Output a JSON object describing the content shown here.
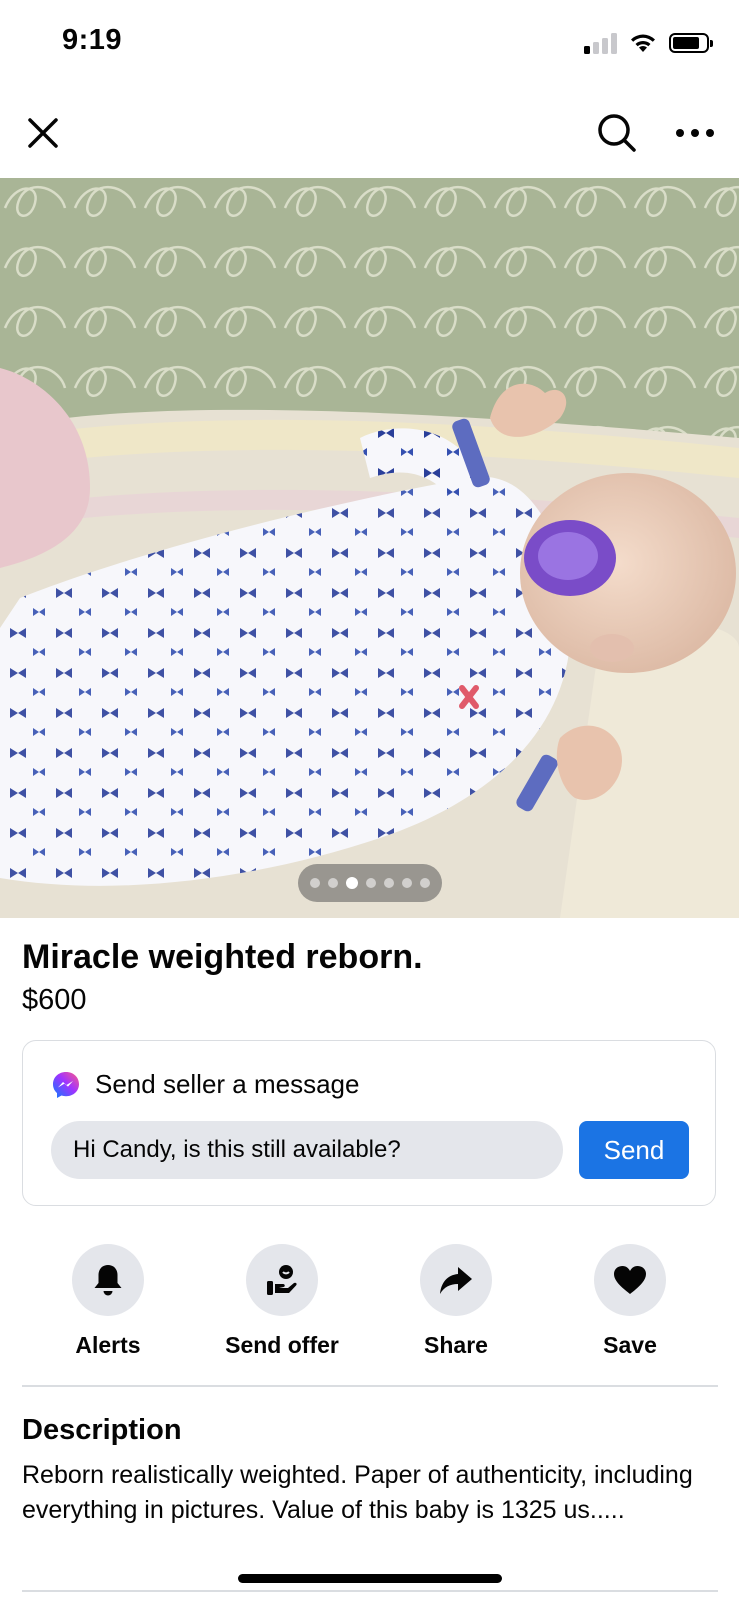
{
  "status_bar": {
    "time": "9:19",
    "signal_bars_on": 1,
    "battery_level": 0.8
  },
  "nav": {
    "close_icon": "close-icon",
    "search_icon": "search-icon",
    "more_icon": "more-icon"
  },
  "photo": {
    "slide_count": 7,
    "active_slide": 3
  },
  "listing": {
    "title": "Miracle weighted reborn.",
    "price": "$600"
  },
  "message": {
    "header": "Send seller a message",
    "input_value": "Hi Candy, is this still available?",
    "send_label": "Send"
  },
  "actions": [
    {
      "label": "Alerts",
      "icon": "bell-icon"
    },
    {
      "label": "Send offer",
      "icon": "offer-icon"
    },
    {
      "label": "Share",
      "icon": "share-icon"
    },
    {
      "label": "Save",
      "icon": "heart-icon"
    }
  ],
  "description": {
    "heading": "Description",
    "body": "Reborn realistically weighted. Paper of authenticity, including everything in pictures. Value of this baby is 1325 us....."
  },
  "colors": {
    "accent": "#1b74e4",
    "button_bg": "#e4e6eb",
    "divider": "#dadde1"
  }
}
